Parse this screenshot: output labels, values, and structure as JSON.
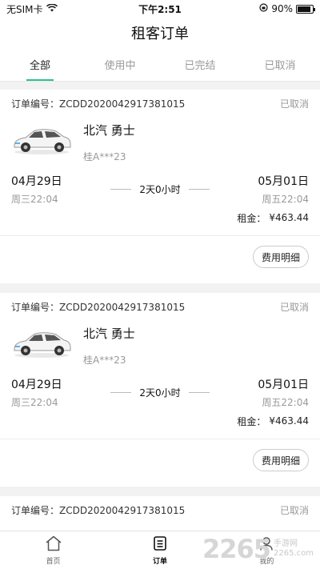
{
  "status_bar": {
    "carrier": "无SIM卡",
    "time": "下午2:51",
    "battery": "90%",
    "battery_level": 0.9
  },
  "nav": {
    "title": "租客订单"
  },
  "tabs": [
    {
      "label": "全部"
    },
    {
      "label": "使用中"
    },
    {
      "label": "已完结"
    },
    {
      "label": "已取消"
    }
  ],
  "orders": [
    {
      "order_no": "订单编号：ZCDD2020042917381015",
      "status": "已取消",
      "car_name": "北汽  勇士",
      "plate": "桂A***23",
      "start_date": "04月29日",
      "start_week": "周三22:04",
      "duration": "2天0小时",
      "end_date": "05月01日",
      "end_week": "周五22:04",
      "rent_label": "租金：",
      "rent_value": "¥463.44",
      "detail_btn": "费用明细"
    },
    {
      "order_no": "订单编号：ZCDD2020042917381015",
      "status": "已取消",
      "car_name": "北汽  勇士",
      "plate": "桂A***23",
      "start_date": "04月29日",
      "start_week": "周三22:04",
      "duration": "2天0小时",
      "end_date": "05月01日",
      "end_week": "周五22:04",
      "rent_label": "租金：",
      "rent_value": "¥463.44",
      "detail_btn": "费用明细"
    },
    {
      "order_no": "订单编号：ZCDD2020042917381015",
      "status": "已取消"
    }
  ],
  "bottom_nav": [
    {
      "label": "首页",
      "icon": "home-icon"
    },
    {
      "label": "订单",
      "icon": "order-icon"
    },
    {
      "label": "我的",
      "icon": "profile-icon"
    }
  ],
  "watermark": {
    "number": "2265",
    "text1": "手游网",
    "text2": "2265.com"
  },
  "colors": {
    "accent": "#2ec18c",
    "muted": "#999999"
  }
}
